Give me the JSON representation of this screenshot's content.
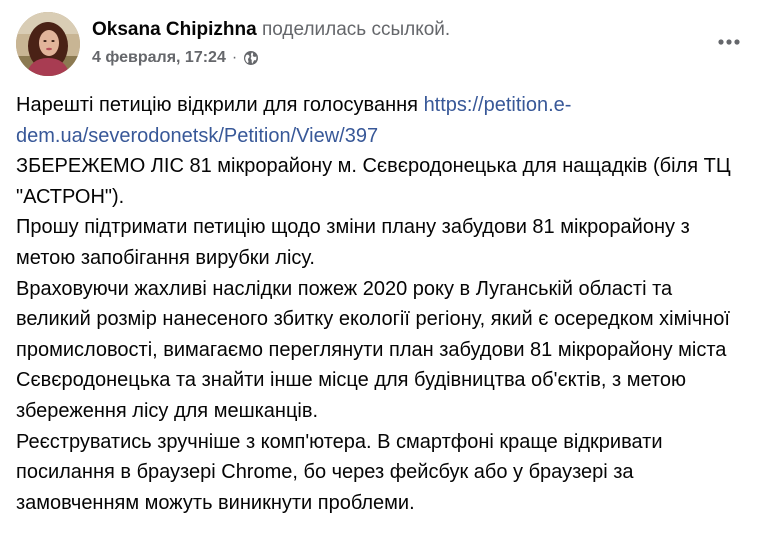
{
  "author": {
    "name": "Oksana Chipizhna",
    "action": "поделилась ссылкой."
  },
  "meta": {
    "date": "4 февраля, 17:24",
    "separator": "·",
    "privacy_icon": "globe-icon"
  },
  "more_icon": "more-options-icon",
  "post": {
    "p1_text": "Нарешті петицію відкрили для голосування ",
    "p1_link": "https://petition.e-dem.ua/severodonetsk/Petition/View/397",
    "p2": "ЗБЕРЕЖЕМО ЛІС 81 мікрорайону м. Сєвєродонецька для нащадків (біля ТЦ \"АСТРОН\").",
    "p3": "Прошу підтримати петицію щодо зміни плану забудови 81 мікрорайону з метою запобігання вирубки лісу.",
    "p4": "Враховуючи жахливі наслідки пожеж 2020 року в Луганській області та великий розмір нанесеного збитку екології регіону, який є осередком хімічної промисловості, вимагаємо переглянути план забудови 81 мікрорайону міста Сєвєродонецька та знайти інше місце для будівництва об'єктів, з метою збереження лісу для мешканців.",
    "p5": "Реєструватись зручніше з комп'ютера. В смартфоні краще відкривати посилання в браузері Chrome, бо через фейсбук або у браузері за замовченням можуть виникнути проблеми."
  },
  "colors": {
    "link": "#385898",
    "secondary_text": "#65676b",
    "primary_text": "#050505"
  }
}
